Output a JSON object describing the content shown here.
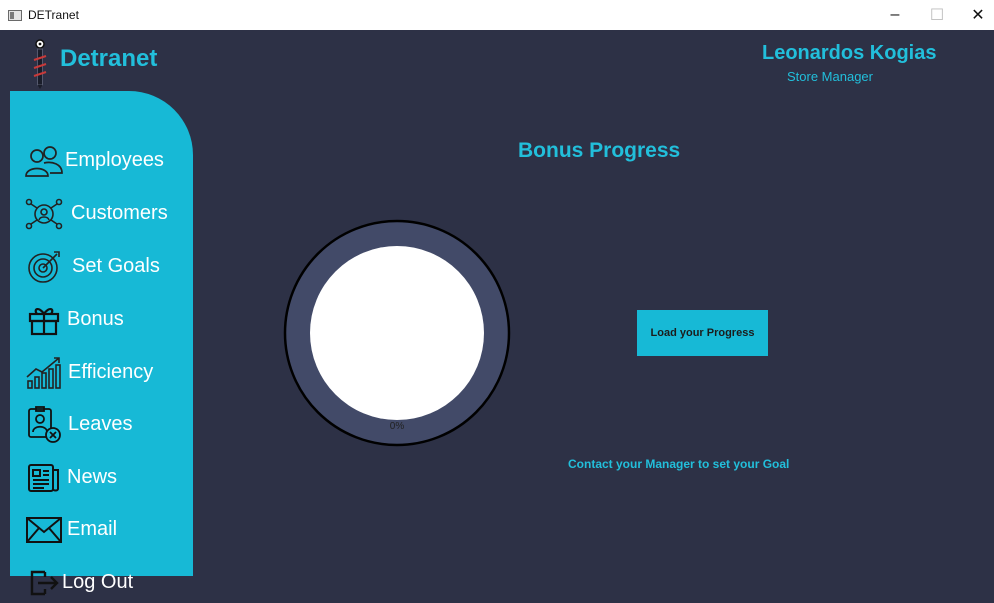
{
  "window": {
    "title": "DETranet",
    "minimize_glyph": "–",
    "maximize_glyph": "☐",
    "close_glyph": "✕"
  },
  "brand": {
    "name": "Detranet",
    "logo_icon": "screw-tool-icon"
  },
  "user": {
    "name": "Leonardos Kogias",
    "role": "Store Manager"
  },
  "sidebar": {
    "items": [
      {
        "label": "Employees",
        "icon": "employees-icon"
      },
      {
        "label": "Customers",
        "icon": "customers-icon"
      },
      {
        "label": "Set Goals",
        "icon": "target-icon"
      },
      {
        "label": "Bonus",
        "icon": "gift-icon"
      },
      {
        "label": "Efficiency",
        "icon": "bar-chart-icon"
      },
      {
        "label": "Leaves",
        "icon": "leaves-icon"
      },
      {
        "label": "News",
        "icon": "newspaper-icon"
      },
      {
        "label": "Email",
        "icon": "envelope-icon"
      },
      {
        "label": "Log Out",
        "icon": "logout-icon"
      }
    ]
  },
  "main": {
    "title": "Bonus Progress",
    "progress": {
      "value": 0,
      "label": "0%"
    },
    "load_button_label": "Load your Progress",
    "message": "Contact your Manager to set your Goal"
  },
  "colors": {
    "accent": "#17b9d6",
    "background": "#2d3146",
    "gauge_ring": "#424a68"
  }
}
